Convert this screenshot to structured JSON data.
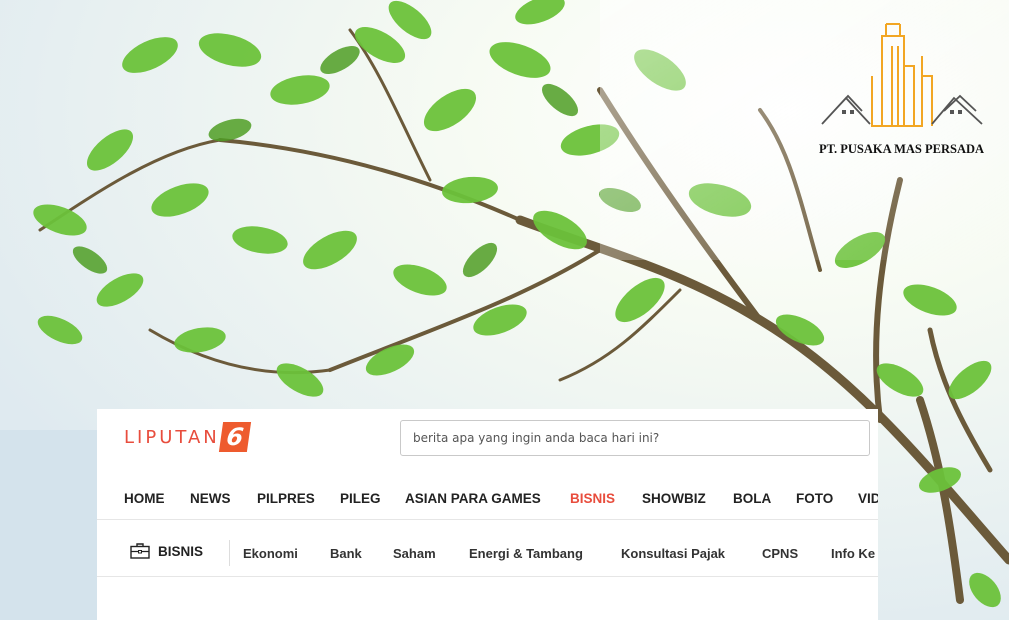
{
  "company": {
    "name": "PT. PUSAKA MAS PERSADA"
  },
  "site": {
    "brand_word": "LIPUTAN",
    "brand_number": "6",
    "search_placeholder": "berita apa yang ingin anda baca hari ini?"
  },
  "nav": {
    "items": [
      "HOME",
      "NEWS",
      "PILPRES",
      "PILEG",
      "ASIAN PARA GAMES",
      "BISNIS",
      "SHOWBIZ",
      "BOLA",
      "FOTO",
      "VID"
    ],
    "active": "BISNIS",
    "active_color": "#e84d3d"
  },
  "subnav": {
    "section": "BISNIS",
    "section_icon": "briefcase-icon",
    "items": [
      "Ekonomi",
      "Bank",
      "Saham",
      "Energi & Tambang",
      "Konsultasi Pajak",
      "CPNS",
      "Info Ke"
    ]
  },
  "colors": {
    "brand": "#e84d3d",
    "brand_badge": "#ee5b2e",
    "leaf": "#6cc23a",
    "gold": "#f2a623"
  }
}
